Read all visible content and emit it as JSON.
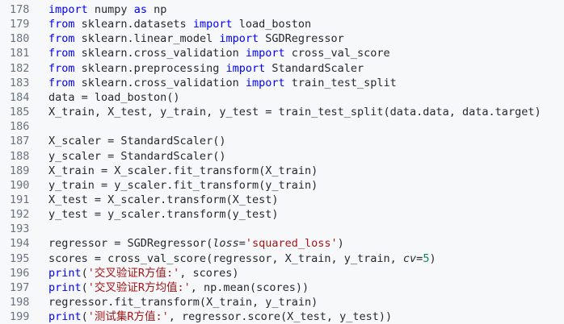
{
  "editor": {
    "lines": [
      {
        "n": "178",
        "tokens": [
          {
            "t": "import",
            "c": "kw"
          },
          {
            "t": " numpy "
          },
          {
            "t": "as",
            "c": "kw"
          },
          {
            "t": " np"
          }
        ]
      },
      {
        "n": "179",
        "tokens": [
          {
            "t": "from",
            "c": "kw"
          },
          {
            "t": " sklearn.datasets "
          },
          {
            "t": "import",
            "c": "kw"
          },
          {
            "t": " load_boston"
          }
        ]
      },
      {
        "n": "180",
        "tokens": [
          {
            "t": "from",
            "c": "kw"
          },
          {
            "t": " sklearn.linear_model "
          },
          {
            "t": "import",
            "c": "kw"
          },
          {
            "t": " SGDRegressor"
          }
        ]
      },
      {
        "n": "181",
        "tokens": [
          {
            "t": "from",
            "c": "kw"
          },
          {
            "t": " sklearn.cross_validation "
          },
          {
            "t": "import",
            "c": "kw"
          },
          {
            "t": " cross_val_score"
          }
        ]
      },
      {
        "n": "182",
        "tokens": [
          {
            "t": "from",
            "c": "kw"
          },
          {
            "t": " sklearn.preprocessing "
          },
          {
            "t": "import",
            "c": "kw"
          },
          {
            "t": " StandardScaler"
          }
        ]
      },
      {
        "n": "183",
        "tokens": [
          {
            "t": "from",
            "c": "kw"
          },
          {
            "t": " sklearn.cross_validation "
          },
          {
            "t": "import",
            "c": "kw"
          },
          {
            "t": " train_test_split"
          }
        ]
      },
      {
        "n": "184",
        "tokens": [
          {
            "t": "data = load_boston()"
          }
        ]
      },
      {
        "n": "185",
        "tokens": [
          {
            "t": "X_train, X_test, y_train, y_test = train_test_split(data.data, data.target)"
          }
        ]
      },
      {
        "n": "186",
        "tokens": []
      },
      {
        "n": "187",
        "tokens": [
          {
            "t": "X_scaler = StandardScaler()"
          }
        ]
      },
      {
        "n": "188",
        "tokens": [
          {
            "t": "y_scaler = StandardScaler()"
          }
        ]
      },
      {
        "n": "189",
        "tokens": [
          {
            "t": "X_train = X_scaler.fit_transform(X_train)"
          }
        ]
      },
      {
        "n": "190",
        "tokens": [
          {
            "t": "y_train = y_scaler.fit_transform(y_train)"
          }
        ]
      },
      {
        "n": "191",
        "tokens": [
          {
            "t": "X_test = X_scaler.transform(X_test)"
          }
        ]
      },
      {
        "n": "192",
        "tokens": [
          {
            "t": "y_test = y_scaler.transform(y_test)"
          }
        ]
      },
      {
        "n": "193",
        "tokens": []
      },
      {
        "n": "194",
        "tokens": [
          {
            "t": "regressor = SGDRegressor("
          },
          {
            "t": "loss",
            "c": "param"
          },
          {
            "t": "="
          },
          {
            "t": "'squared_loss'",
            "c": "str"
          },
          {
            "t": ")"
          }
        ]
      },
      {
        "n": "195",
        "tokens": [
          {
            "t": "scores = cross_val_score(regressor, X_train, y_train, "
          },
          {
            "t": "cv",
            "c": "param"
          },
          {
            "t": "="
          },
          {
            "t": "5",
            "c": "num"
          },
          {
            "t": ")"
          }
        ]
      },
      {
        "n": "196",
        "tokens": [
          {
            "t": "print",
            "c": "bi"
          },
          {
            "t": "("
          },
          {
            "t": "'交叉验证R方值:'",
            "c": "str"
          },
          {
            "t": ", scores)"
          }
        ]
      },
      {
        "n": "197",
        "tokens": [
          {
            "t": "print",
            "c": "bi"
          },
          {
            "t": "("
          },
          {
            "t": "'交叉验证R方均值:'",
            "c": "str"
          },
          {
            "t": ", np.mean(scores))"
          }
        ]
      },
      {
        "n": "198",
        "tokens": [
          {
            "t": "regressor.fit_transform(X_train, y_train)"
          }
        ]
      },
      {
        "n": "199",
        "tokens": [
          {
            "t": "print",
            "c": "bi"
          },
          {
            "t": "("
          },
          {
            "t": "'测试集R方值:'",
            "c": "str"
          },
          {
            "t": ", regressor.score(X_test, y_test))"
          }
        ]
      }
    ]
  }
}
